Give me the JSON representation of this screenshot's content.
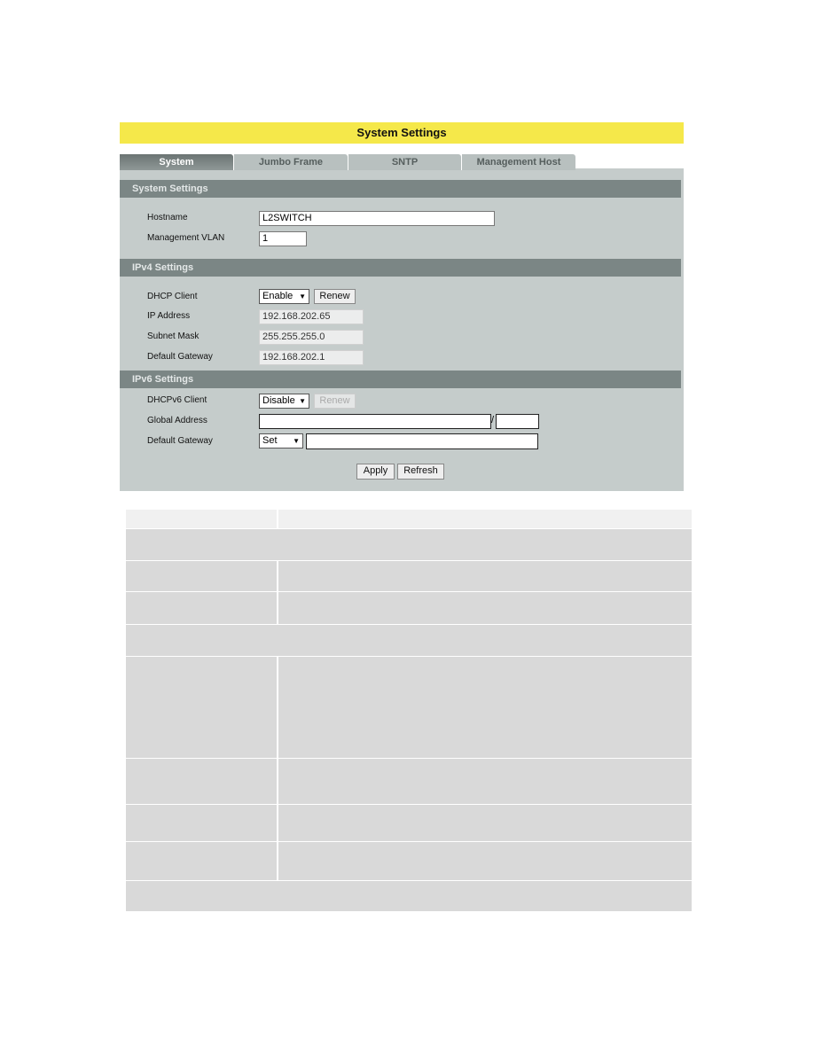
{
  "title": "System Settings",
  "tabs": [
    {
      "label": "System",
      "active": true
    },
    {
      "label": "Jumbo Frame"
    },
    {
      "label": "SNTP"
    },
    {
      "label": "Management Host"
    }
  ],
  "system": {
    "header": "System Settings",
    "hostname_label": "Hostname",
    "hostname_value": "L2SWITCH",
    "vlan_label": "Management VLAN",
    "vlan_value": "1"
  },
  "ipv4": {
    "header": "IPv4 Settings",
    "dhcp_label": "DHCP Client",
    "dhcp_value": "Enable",
    "renew_label": "Renew",
    "ip_label": "IP Address",
    "ip_value": "192.168.202.65",
    "mask_label": "Subnet Mask",
    "mask_value": "255.255.255.0",
    "gw_label": "Default Gateway",
    "gw_value": "192.168.202.1"
  },
  "ipv6": {
    "header": "IPv6 Settings",
    "dhcp_label": "DHCPv6 Client",
    "dhcp_value": "Disable",
    "renew_label": "Renew",
    "global_label": "Global Address",
    "global_value": "",
    "slash": "/",
    "prefix_value": "",
    "gw_label": "Default Gateway",
    "gw_mode": "Set",
    "gw_value": ""
  },
  "actions": {
    "apply": "Apply",
    "refresh": "Refresh"
  },
  "colors": {
    "title_bar": "#f5e84a",
    "section_header": "#7b8685",
    "panel": "#c5cccb",
    "table_cell": "#d9d9d9"
  }
}
